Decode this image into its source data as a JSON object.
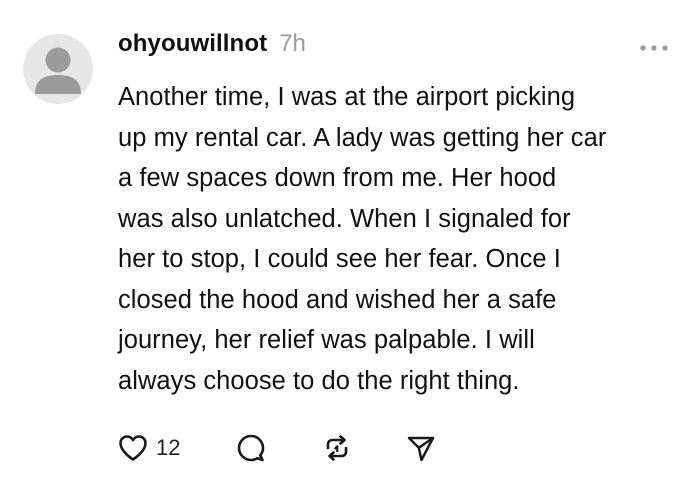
{
  "post": {
    "username": "ohyouwillnot",
    "timestamp": "7h",
    "body": "Another time, I was at the airport picking\nup my rental car. A lady was getting her car\na few spaces down from me. Her hood\nwas also unlatched. When I signaled for\nher to stop, I could see her fear. Once I\nclosed the hood and wished her a safe\njourney, her relief was palpable. I will\nalways choose to do the right thing.",
    "like_count": "12"
  },
  "icons": {
    "avatar": "default-user-avatar",
    "more": "more-options-icon",
    "like": "heart-icon",
    "reply": "comment-icon",
    "repost": "repost-icon",
    "share": "send-icon"
  },
  "colors": {
    "text": "#111111",
    "muted": "#9a9a9a",
    "avatar_bg": "#e6e6e6",
    "avatar_fg": "#9b9b9b"
  }
}
